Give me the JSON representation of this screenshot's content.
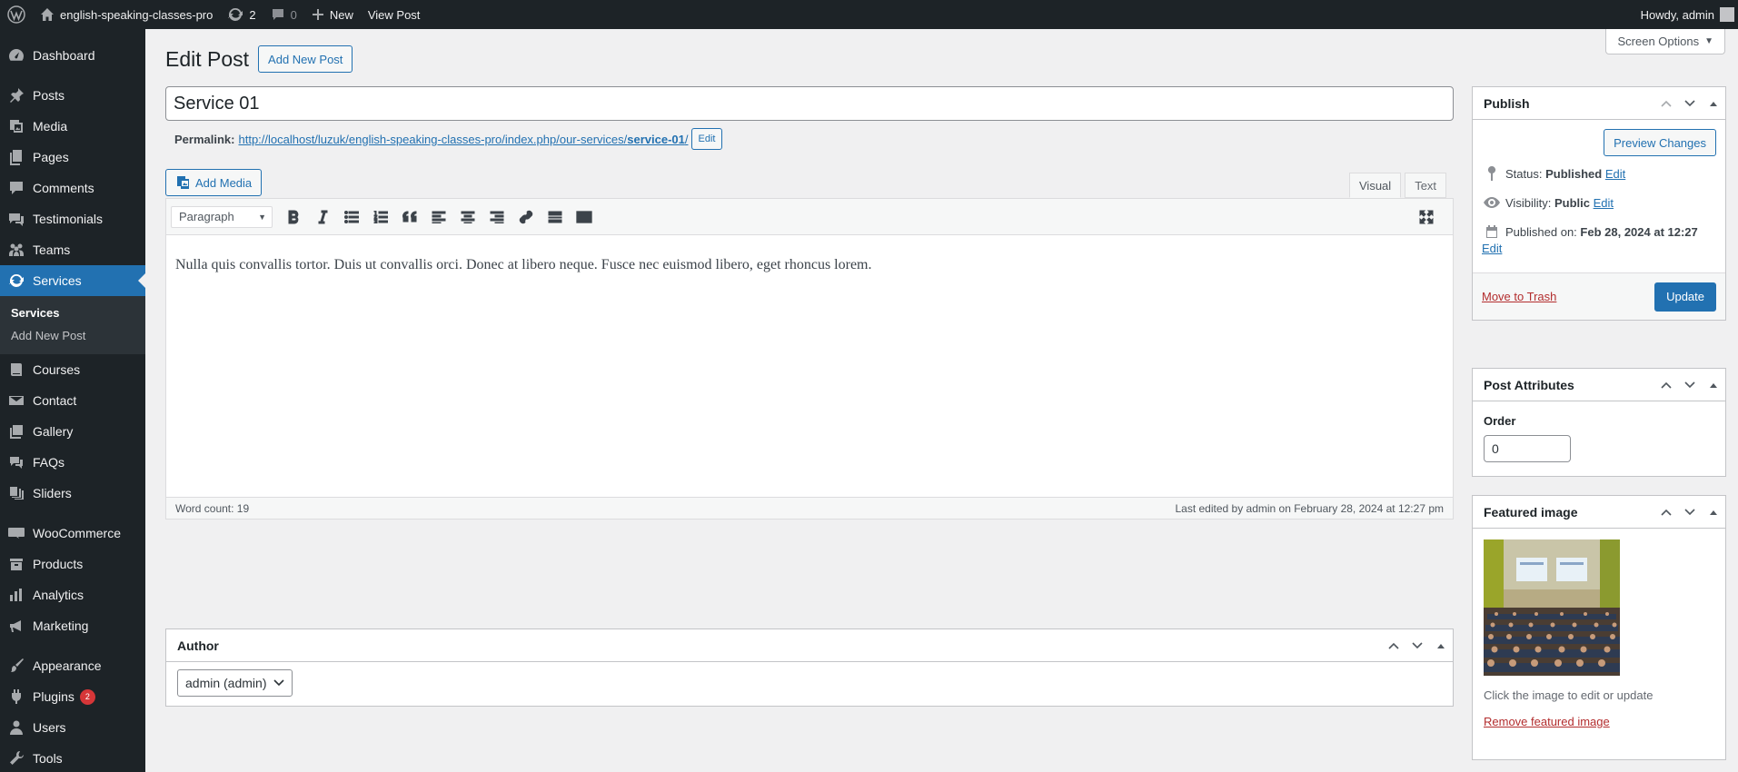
{
  "adminbar": {
    "site_name": "english-speaking-classes-pro",
    "updates_count": "2",
    "comments_count": "0",
    "new_label": "New",
    "view_post_label": "View Post",
    "howdy": "Howdy, admin"
  },
  "sidebar": {
    "items": [
      {
        "label": "Dashboard",
        "icon": "dashboard-icon"
      },
      {
        "label": "Posts",
        "icon": "pin-icon"
      },
      {
        "label": "Media",
        "icon": "media-icon"
      },
      {
        "label": "Pages",
        "icon": "pages-icon"
      },
      {
        "label": "Comments",
        "icon": "comment-icon"
      },
      {
        "label": "Testimonials",
        "icon": "testimonial-icon"
      },
      {
        "label": "Teams",
        "icon": "teams-icon"
      },
      {
        "label": "Services",
        "icon": "services-icon"
      },
      {
        "label": "Courses",
        "icon": "courses-icon"
      },
      {
        "label": "Contact",
        "icon": "email-icon"
      },
      {
        "label": "Gallery",
        "icon": "gallery-icon"
      },
      {
        "label": "FAQs",
        "icon": "faq-icon"
      },
      {
        "label": "Sliders",
        "icon": "sliders-icon"
      },
      {
        "label": "WooCommerce",
        "icon": "woo-icon"
      },
      {
        "label": "Products",
        "icon": "products-icon"
      },
      {
        "label": "Analytics",
        "icon": "analytics-icon"
      },
      {
        "label": "Marketing",
        "icon": "megaphone-icon"
      },
      {
        "label": "Appearance",
        "icon": "brush-icon"
      },
      {
        "label": "Plugins",
        "icon": "plugin-icon",
        "badge": "2"
      },
      {
        "label": "Users",
        "icon": "users-icon"
      },
      {
        "label": "Tools",
        "icon": "tools-icon"
      }
    ],
    "submenu": [
      "Services",
      "Add New Post"
    ]
  },
  "header": {
    "title": "Edit Post",
    "add_new_label": "Add New Post",
    "screen_options": "Screen Options"
  },
  "post": {
    "title": "Service 01",
    "permalink_label": "Permalink:",
    "permalink_base": "http://localhost/luzuk/english-speaking-classes-pro/index.php/our-services/",
    "permalink_slug": "service-01",
    "permalink_trailing": "/",
    "permalink_edit": "Edit",
    "add_media_label": "Add Media",
    "tab_visual": "Visual",
    "tab_text": "Text",
    "format_value": "Paragraph",
    "content": "Nulla quis convallis tortor. Duis ut convallis orci. Donec at libero neque. Fusce nec euismod libero, eget rhoncus lorem.",
    "word_count": "Word count: 19",
    "last_edited": "Last edited by admin on February 28, 2024 at 12:27 pm"
  },
  "author": {
    "title": "Author",
    "selected": "admin (admin)"
  },
  "publish": {
    "title": "Publish",
    "preview_label": "Preview Changes",
    "status_label": "Status:",
    "status_value": "Published",
    "visibility_label": "Visibility:",
    "visibility_value": "Public",
    "published_label": "Published on:",
    "published_value": "Feb 28, 2024 at 12:27",
    "edit_label": "Edit",
    "trash_label": "Move to Trash",
    "update_label": "Update"
  },
  "attributes": {
    "title": "Post Attributes",
    "order_label": "Order",
    "order_value": "0"
  },
  "featured": {
    "title": "Featured image",
    "hint": "Click the image to edit or update",
    "remove_label": "Remove featured image"
  }
}
